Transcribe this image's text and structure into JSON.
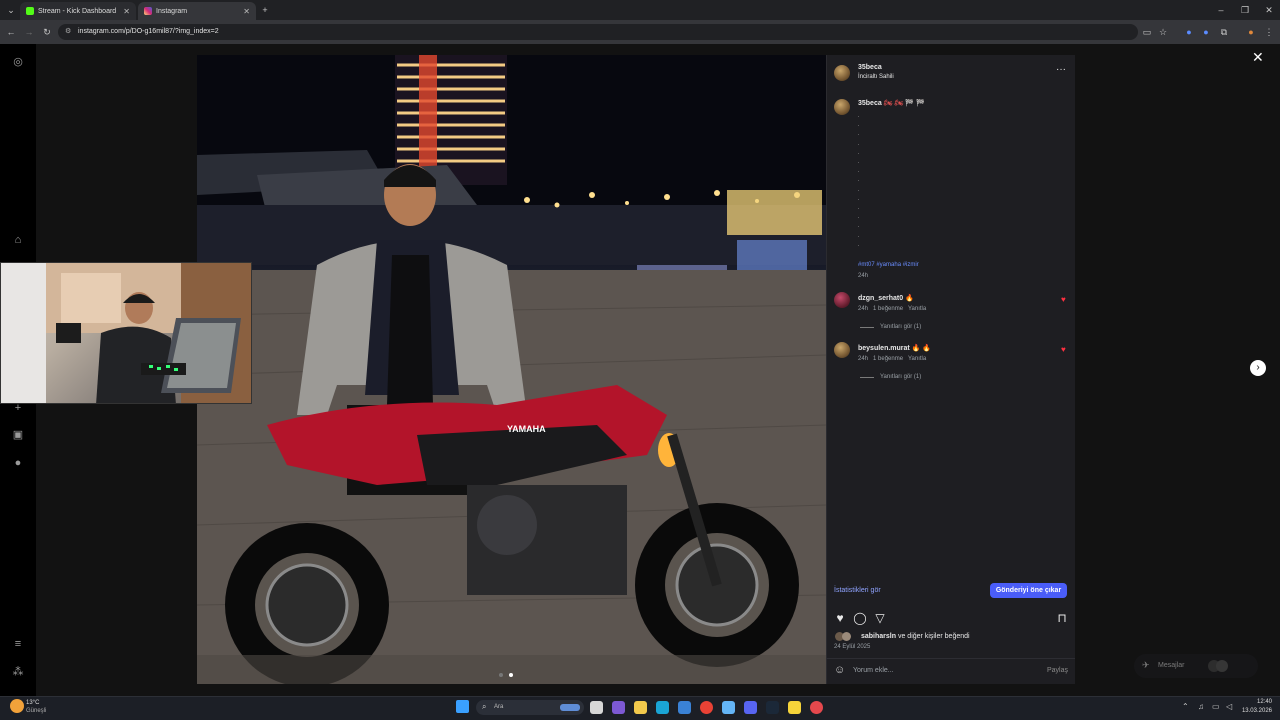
{
  "browser": {
    "tabs": [
      {
        "title": "Stream - Kick Dashboard",
        "active": false,
        "favicon_color": "#53fc18"
      },
      {
        "title": "Instagram",
        "active": true,
        "favicon_color": "#e1306c"
      }
    ],
    "url": "instagram.com/p/DO-g16mil87/?img_index=2"
  },
  "post": {
    "author": "35beca",
    "location": "İnciraltı Sahili",
    "caption_author": "35beca",
    "caption_emojis": "🏍 🏍 🏁 🏁",
    "caption_dots": [
      ".",
      ".",
      ".",
      ".",
      ".",
      ".",
      ".",
      ".",
      ".",
      ".",
      ".",
      ".",
      ".",
      ".",
      "."
    ],
    "hashtags": "#mt07 #yamaha #izmir",
    "caption_time": "24h",
    "comments": [
      {
        "user": "dzgn_serhat0",
        "emoji": "🔥",
        "time": "24h",
        "likes": "1 beğenme",
        "reply": "Yanıtla",
        "view_replies": "Yanıtları gör (1)"
      },
      {
        "user": "beysulen.murat",
        "emoji": "🔥 🔥",
        "time": "24h",
        "likes": "1 beğenme",
        "reply": "Yanıtla",
        "view_replies": "Yanıtları gör (1)"
      }
    ],
    "insights_link": "İstatistikleri gör",
    "feature_button": "Gönderiyi öne çıkar",
    "likes_text_user": "sabiharsln",
    "likes_text_rest": "ve diğer kişiler beğendi",
    "date": "24 Eylül 2025",
    "comment_placeholder": "Yorum ekle...",
    "share_label": "Paylaş"
  },
  "photo": {
    "motorcycle_brand": "YAMAHA"
  },
  "messages": {
    "label": "Mesajlar"
  },
  "taskbar": {
    "weather_temp": "13°C",
    "weather_desc": "Güneşli",
    "search_placeholder": "Ara",
    "time": "12:40",
    "date": "13.03.2026"
  },
  "colors": {
    "accent": "#4a5df9",
    "heart": "#ff3040",
    "panel_bg": "#1e1e22"
  }
}
